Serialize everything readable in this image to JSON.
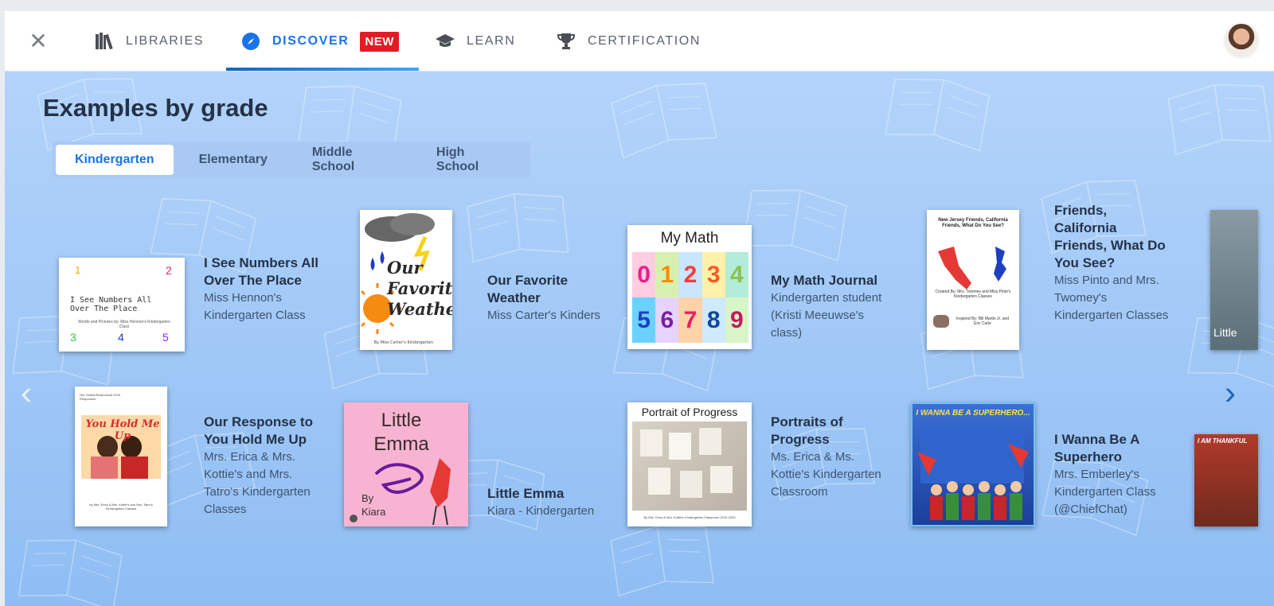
{
  "nav": {
    "close_label": "✕",
    "items": [
      {
        "label": "LIBRARIES",
        "icon": "libraries-icon"
      },
      {
        "label": "DISCOVER",
        "icon": "compass-icon",
        "badge": "NEW"
      },
      {
        "label": "LEARN",
        "icon": "graduation-cap-icon"
      },
      {
        "label": "CERTIFICATION",
        "icon": "trophy-icon"
      }
    ],
    "active_color": "#1a73e8",
    "badge_color": "#e31b23"
  },
  "section": {
    "title": "Examples by grade",
    "tabs": [
      "Kindergarten",
      "Elementary",
      "Middle School",
      "High School"
    ],
    "selected_tab": "Kindergarten"
  },
  "books": [
    {
      "title": "I See Numbers All Over The Place",
      "author": "Miss Hennon's Kindergarten Class",
      "cover_text": "I See Numbers All Over The Place",
      "cover_sub": "Words and Pictures by: Miss Hennon's Kindergarten Class",
      "cover_numbers": [
        "1",
        "2",
        "3",
        "4",
        "5"
      ]
    },
    {
      "title": "Our Favorite Weather",
      "author": "Miss Carter's Kinders",
      "cover_text": "Our Favorite Weather",
      "cover_sub": "By Miss Carter's Kindergarten"
    },
    {
      "title": "My Math Journal",
      "author": "Kindergarten student (Kristi Meeuwse's class)",
      "cover_text": "My Math",
      "cover_numbers": [
        "0",
        "1",
        "2",
        "3",
        "4",
        "5",
        "6",
        "7",
        "8",
        "9"
      ]
    },
    {
      "title": "Friends, California Friends, What Do You See?",
      "author": "Miss Pinto and Mrs. Twomey's Kindergarten Classes",
      "cover_text": "New Jersey Friends, California Friends, What Do You See?",
      "cover_sub": "Created By: Mrs. Twomey and Miss Pinto's Kindergarten Classes",
      "cover_sub2": "Inspired By: Bill Martin Jr. and Eric Carle"
    },
    {
      "title": "Our Response to You Hold Me Up",
      "author": "Mrs. Erica & Mrs. Kottie's and Mrs. Tatro's Kindergarten Classes",
      "cover_text": "You Hold Me Up",
      "cover_sub": "Our Global Read Aloud 2019 Responses",
      "cover_sub2": "by Mrs. Erica & Mrs. Kottie's and Mrs. Tatro's Kindergarten Classes"
    },
    {
      "title": "Little Emma",
      "author": "Kiara - Kindergarten",
      "cover_text": "Little Emma",
      "cover_sub": "By Kiara"
    },
    {
      "title": "Portraits of Progress",
      "author": "Ms. Erica & Ms. Kottie's Kindergarten Classroom",
      "cover_text": "Portrait of Progress",
      "cover_sub": "By Mrs. Erica & Mrs. Kottie's Kindergarten Classroom 2019-2020"
    },
    {
      "title": "I Wanna Be A Superhero",
      "author": "Mrs. Emberley's Kindergarten Class (@ChiefChat)",
      "cover_text": "I WANNA BE A SUPERHERO..."
    }
  ],
  "peek_covers": [
    "Little",
    "I AM THANKFUL"
  ],
  "arrows": {
    "left": "‹",
    "right": "›"
  }
}
